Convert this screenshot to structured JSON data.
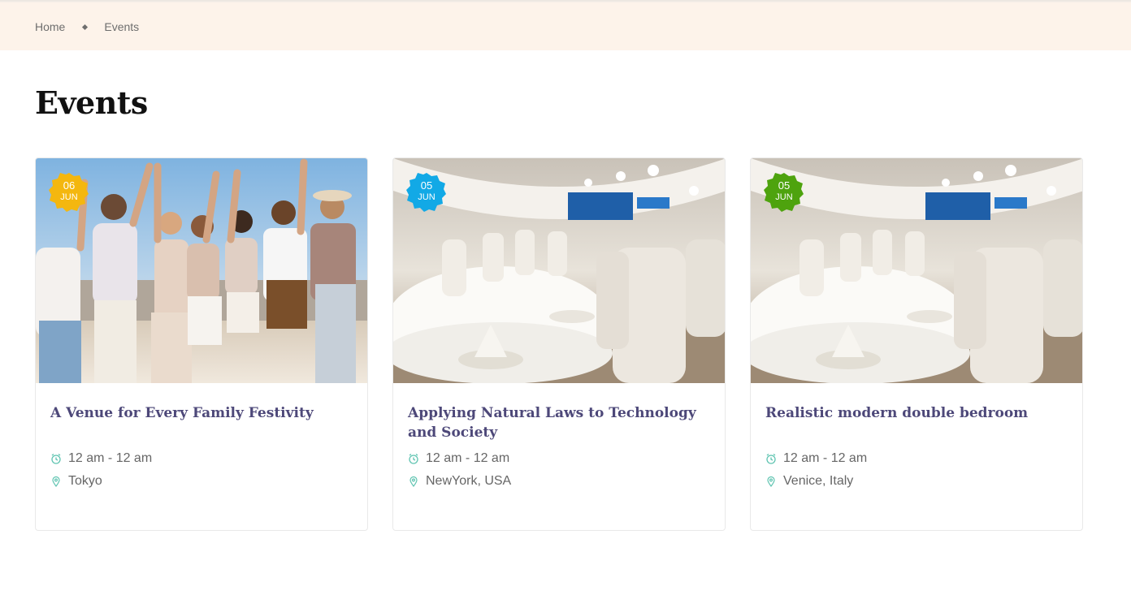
{
  "breadcrumb": {
    "home": "Home",
    "current": "Events"
  },
  "page": {
    "title": "Events"
  },
  "events": [
    {
      "day": "06",
      "month": "JUN",
      "badge_color": "#f4b70f",
      "title": "A Venue for Every Family Festivity",
      "time": "12 am - 12 am",
      "location": "Tokyo",
      "image": "group-of-friends-photo"
    },
    {
      "day": "05",
      "month": "JUN",
      "badge_color": "#12a9e6",
      "title": "Applying Natural Laws to Technology and Society",
      "time": "12 am - 12 am",
      "location": "NewYork, USA",
      "image": "banquet-hall-photo"
    },
    {
      "day": "05",
      "month": "JUN",
      "badge_color": "#4ea30e",
      "title": "Realistic modern double bedroom",
      "time": "12 am - 12 am",
      "location": "Venice, Italy",
      "image": "banquet-hall-photo"
    }
  ],
  "colors": {
    "accent_icon": "#5fc4b1",
    "title": "#4d4879",
    "breadcrumb_bg": "#fdf3ea"
  },
  "icons": {
    "time": "clock-icon",
    "location": "map-pin-icon",
    "separator": "diamond-icon"
  }
}
